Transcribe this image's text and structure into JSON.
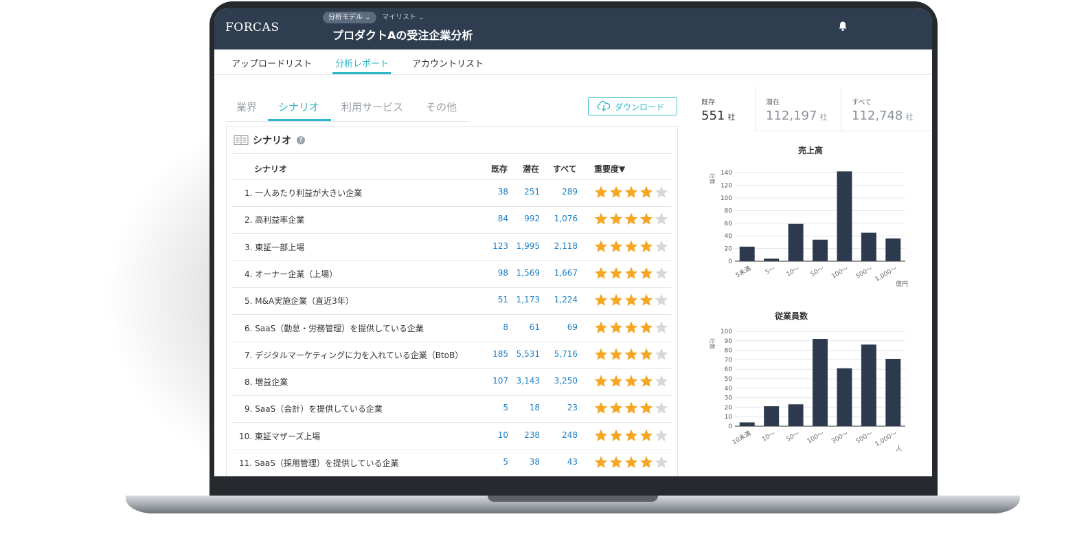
{
  "app": {
    "logo": "FORCAS",
    "model_pill": "分析モデル ⌄",
    "mylist": "マイリスト ⌄",
    "title": "プロダクトAの受注企業分析"
  },
  "subnav": [
    {
      "label": "アップロードリスト"
    },
    {
      "label": "分析レポート",
      "active": true
    },
    {
      "label": "アカウントリスト"
    }
  ],
  "tabs": [
    {
      "label": "業界"
    },
    {
      "label": "シナリオ",
      "active": true
    },
    {
      "label": "利用サービス"
    },
    {
      "label": "その他"
    }
  ],
  "download_label": "ダウンロード",
  "panel": {
    "title": "シナリオ",
    "help": "?",
    "columns": {
      "name": "シナリオ",
      "existing": "既存",
      "potential": "潜在",
      "all": "すべて",
      "importance": "重要度▼"
    },
    "rows": [
      {
        "name": "1. 一人あたり利益が大きい企業",
        "existing": "38",
        "potential": "251",
        "all": "289",
        "stars": 4.5
      },
      {
        "name": "2. 高利益率企業",
        "existing": "84",
        "potential": "992",
        "all": "1,076",
        "stars": 4.5
      },
      {
        "name": "3. 東証一部上場",
        "existing": "123",
        "potential": "1,995",
        "all": "2,118",
        "stars": 4.5
      },
      {
        "name": "4. オーナー企業（上場）",
        "existing": "98",
        "potential": "1,569",
        "all": "1,667",
        "stars": 4.5
      },
      {
        "name": "5. M&A実施企業（直近3年）",
        "existing": "51",
        "potential": "1,173",
        "all": "1,224",
        "stars": 4
      },
      {
        "name": "6. SaaS（勤怠・労務管理）を提供している企業",
        "existing": "8",
        "potential": "61",
        "all": "69",
        "stars": 4
      },
      {
        "name": "7. デジタルマーケティングに力を入れている企業（BtoB）",
        "existing": "185",
        "potential": "5,531",
        "all": "5,716",
        "stars": 4
      },
      {
        "name": "8. 増益企業",
        "existing": "107",
        "potential": "3,143",
        "all": "3,250",
        "stars": 4
      },
      {
        "name": "9. SaaS（会計）を提供している企業",
        "existing": "5",
        "potential": "18",
        "all": "23",
        "stars": 4
      },
      {
        "name": "10. 東証マザーズ上場",
        "existing": "10",
        "potential": "238",
        "all": "248",
        "stars": 4
      },
      {
        "name": "11. SaaS（採用管理）を提供している企業",
        "existing": "5",
        "potential": "38",
        "all": "43",
        "stars": 4
      }
    ]
  },
  "kpis": [
    {
      "label": "既存",
      "value": "551",
      "unit": "社"
    },
    {
      "label": "潜在",
      "value": "112,197",
      "unit": "社"
    },
    {
      "label": "すべて",
      "value": "112,748",
      "unit": "社"
    }
  ],
  "colors": {
    "accent": "#2bb6c8",
    "link": "#1b7fc7",
    "bar": "#2d3a4e",
    "star": "#f5a623",
    "star_empty": "#d8d8d8",
    "header": "#2f3d50"
  },
  "chart_data": [
    {
      "type": "bar",
      "title": "売上高",
      "ylabel": "社数",
      "unit": "億円",
      "categories": [
        "5未満",
        "5〜",
        "10〜",
        "50〜",
        "100〜",
        "500〜",
        "1,000〜"
      ],
      "values": [
        23,
        4,
        59,
        34,
        142,
        45,
        36
      ],
      "yticks": [
        0,
        20,
        40,
        60,
        80,
        100,
        120,
        140
      ],
      "ylim": [
        0,
        150
      ],
      "grid": true
    },
    {
      "type": "bar",
      "title": "従業員数",
      "ylabel": "社数",
      "unit": "人",
      "categories": [
        "10未満",
        "10〜",
        "50〜",
        "100〜",
        "300〜",
        "500〜",
        "1,000〜"
      ],
      "values": [
        4,
        21,
        23,
        92,
        61,
        86,
        71
      ],
      "yticks": [
        0,
        10,
        20,
        30,
        40,
        50,
        60,
        70,
        80,
        90,
        100
      ],
      "ylim": [
        0,
        100
      ],
      "grid": true
    }
  ]
}
